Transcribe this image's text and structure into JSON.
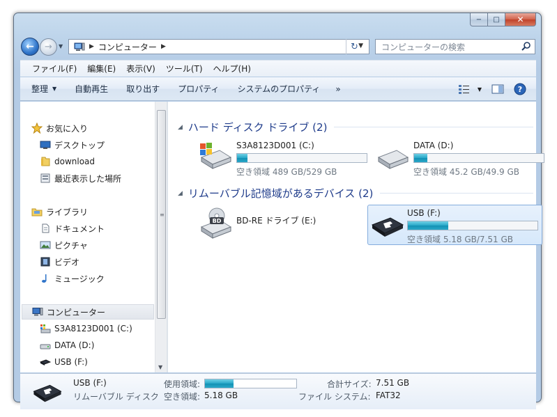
{
  "window": {
    "caption": {
      "minimize": "−",
      "maximize": "□",
      "close": "✕"
    }
  },
  "nav": {
    "back_icon": "back-arrow-icon",
    "forward_icon": "forward-arrow-icon",
    "address": {
      "crumb": "コンピューター"
    },
    "search": {
      "placeholder": "コンピューターの検索"
    }
  },
  "menu": [
    {
      "label": "ファイル(F)"
    },
    {
      "label": "編集(E)"
    },
    {
      "label": "表示(V)"
    },
    {
      "label": "ツール(T)"
    },
    {
      "label": "ヘルプ(H)"
    }
  ],
  "toolbar": {
    "organize": "整理",
    "autoplay": "自動再生",
    "eject": "取り出す",
    "properties": "プロパティ",
    "system_properties": "システムのプロパティ",
    "more": "»"
  },
  "sidebar": {
    "favorites": "お気に入り",
    "desktop": "デスクトップ",
    "download": "download",
    "recent": "最近表示した場所",
    "libraries": "ライブラリ",
    "documents": "ドキュメント",
    "pictures": "ピクチャ",
    "videos": "ビデオ",
    "music": "ミュージック",
    "computer": "コンピューター",
    "drive_c": "S3A8123D001 (C:)",
    "drive_d": "DATA (D:)",
    "drive_f": "USB (F:)"
  },
  "groups": {
    "hdd": "ハード ディスク ドライブ (2)",
    "removable": "リムーバブル記憶域があるデバイス (2)"
  },
  "drives": {
    "c": {
      "name": "S3A8123D001 (C:)",
      "free": "空き領域 489 GB/529 GB",
      "used_fraction": 0.08
    },
    "d": {
      "name": "DATA (D:)",
      "free": "空き領域 45.2 GB/49.9 GB",
      "used_fraction": 0.1
    },
    "e": {
      "name": "BD-RE ドライブ (E:)",
      "badge": "BD"
    },
    "f": {
      "name": "USB (F:)",
      "free": "空き領域 5.18 GB/7.51 GB",
      "used_fraction": 0.31
    }
  },
  "details": {
    "name": "USB (F:)",
    "type": "リムーバブル ディスク",
    "used_label": "使用領域:",
    "used_fraction": 0.31,
    "free_label": "空き領域:",
    "free_value": "5.18 GB",
    "total_label": "合計サイズ:",
    "total_value": "7.51 GB",
    "fs_label": "ファイル システム:",
    "fs_value": "FAT32"
  }
}
